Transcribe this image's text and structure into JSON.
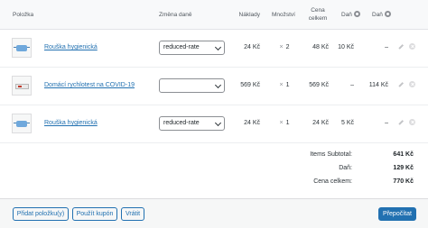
{
  "header": {
    "item": "Položka",
    "tax_change": "Změna daně",
    "cost": "Náklady",
    "qty": "Množství",
    "total": "Cena celkem",
    "tax1": "Daň",
    "tax2": "Daň"
  },
  "rows": [
    {
      "name": "Rouška hygienická",
      "tax_rate": "reduced-rate",
      "cost": "24 Kč",
      "qty_prefix": "×",
      "qty": "2",
      "total": "48 Kč",
      "tax1": "10 Kč",
      "tax2": "–",
      "thumb": "mask"
    },
    {
      "name": "Domácí rychlotest na COVID-19",
      "tax_rate": "",
      "cost": "569 Kč",
      "qty_prefix": "×",
      "qty": "1",
      "total": "569 Kč",
      "tax1": "–",
      "tax2": "114 Kč",
      "thumb": "test-kit"
    },
    {
      "name": "Rouška hygienická",
      "tax_rate": "reduced-rate",
      "cost": "24 Kč",
      "qty_prefix": "×",
      "qty": "1",
      "total": "24 Kč",
      "tax1": "5 Kč",
      "tax2": "–",
      "thumb": "mask"
    }
  ],
  "totals": {
    "subtotal_label": "Items Subtotal:",
    "subtotal_value": "641 Kč",
    "tax_label": "Daň:",
    "tax_value": "129 Kč",
    "total_label": "Cena celkem:",
    "total_value": "770 Kč"
  },
  "actions": {
    "add_item": "Přidat položku(y)",
    "apply_coupon": "Použít kupón",
    "refund": "Vrátit",
    "recalculate": "Přepočítat"
  },
  "colors": {
    "link": "#2271b1",
    "primary_button": "#2271b1"
  }
}
